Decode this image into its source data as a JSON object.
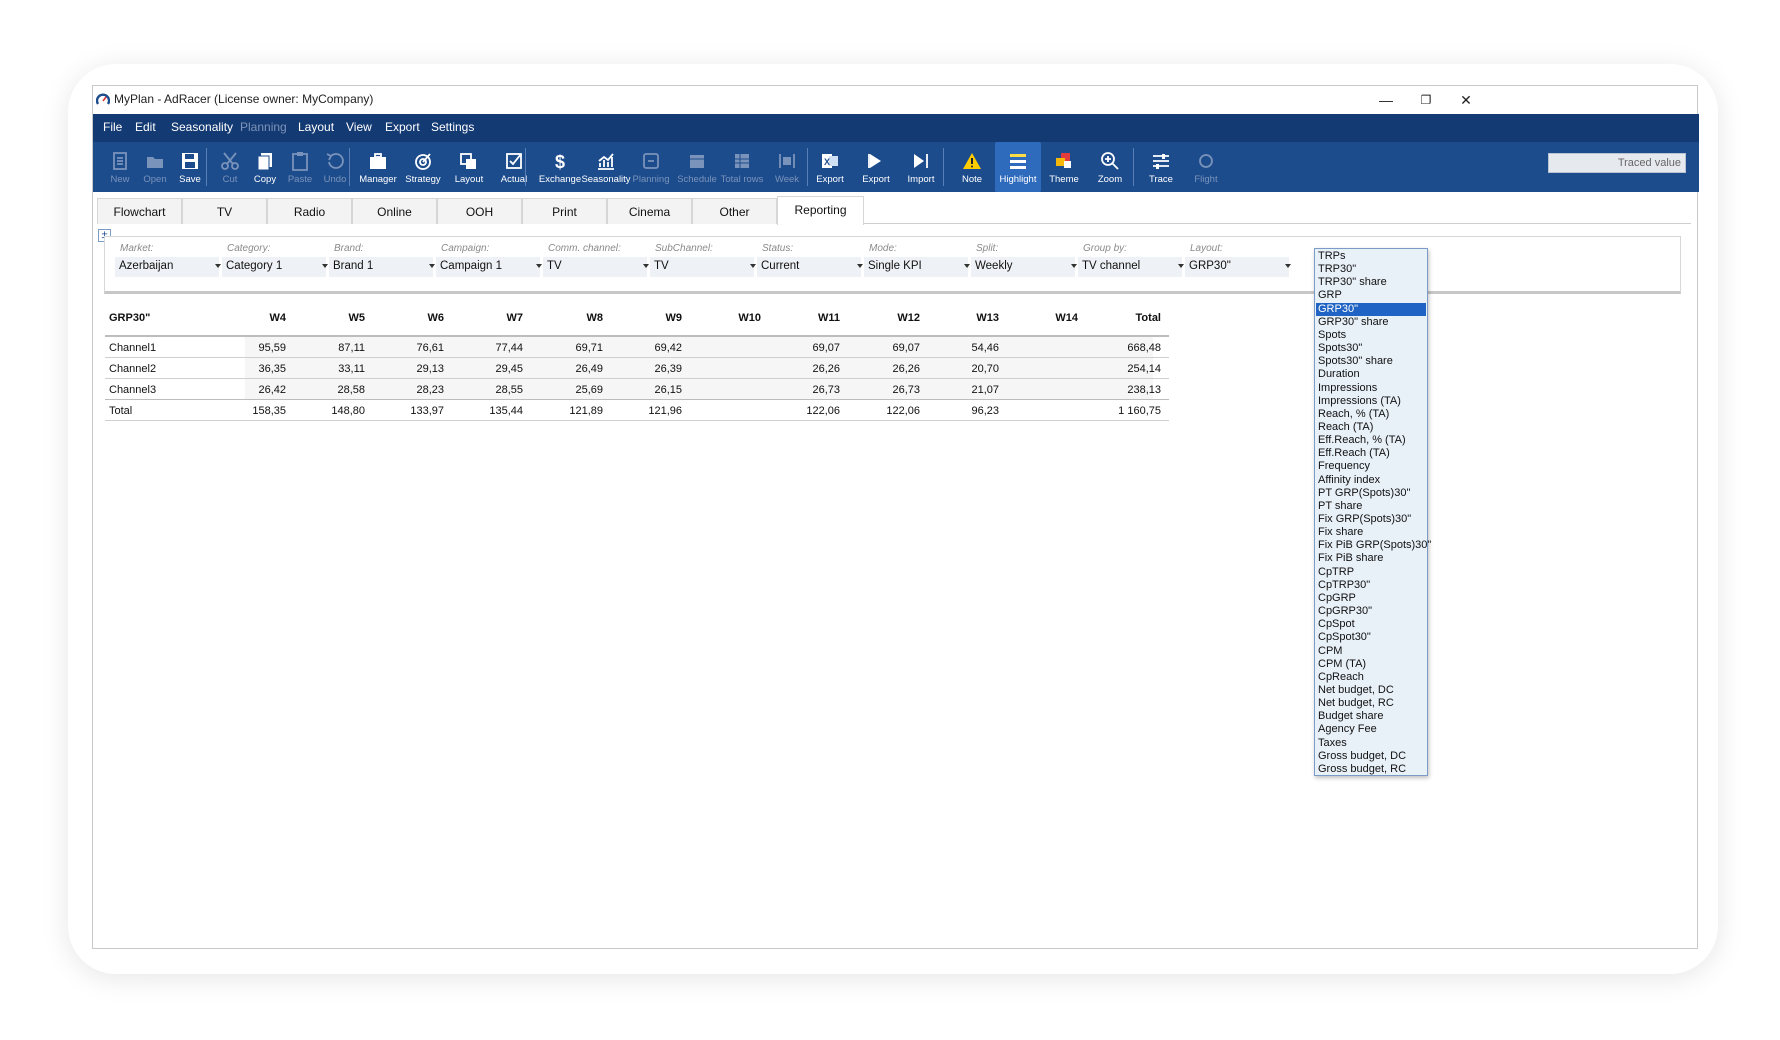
{
  "window": {
    "title": "MyPlan - AdRacer (License owner: MyCompany)",
    "controls": [
      "—",
      "❐",
      "✕"
    ]
  },
  "menu": [
    {
      "label": "File",
      "enabled": true
    },
    {
      "label": "Edit",
      "enabled": true
    },
    {
      "label": "Seasonality",
      "enabled": true
    },
    {
      "label": "Planning",
      "enabled": false
    },
    {
      "label": "Layout",
      "enabled": true
    },
    {
      "label": "View",
      "enabled": true
    },
    {
      "label": "Export",
      "enabled": true
    },
    {
      "label": "Settings",
      "enabled": true
    }
  ],
  "toolbar": {
    "buttons": [
      {
        "label": "New",
        "icon": "new-doc-icon",
        "enabled": false
      },
      {
        "label": "Open",
        "icon": "folder-icon",
        "enabled": false
      },
      {
        "label": "Save",
        "icon": "save-icon",
        "enabled": true
      },
      {
        "label": "Cut",
        "icon": "scissors-icon",
        "enabled": false
      },
      {
        "label": "Copy",
        "icon": "copy-icon",
        "enabled": true
      },
      {
        "label": "Paste",
        "icon": "paste-icon",
        "enabled": false
      },
      {
        "label": "Undo",
        "icon": "undo-icon",
        "enabled": false
      },
      {
        "label": "Manager",
        "icon": "briefcase-icon",
        "enabled": true
      },
      {
        "label": "Strategy",
        "icon": "target-icon",
        "enabled": true
      },
      {
        "label": "Layout",
        "icon": "layout-icon",
        "enabled": true
      },
      {
        "label": "Actual",
        "icon": "check-icon",
        "enabled": true
      },
      {
        "label": "Exchange",
        "icon": "dollar-icon",
        "enabled": true
      },
      {
        "label": "Seasonality",
        "icon": "chart-icon",
        "enabled": true
      },
      {
        "label": "Planning",
        "icon": "planning-icon",
        "enabled": false
      },
      {
        "label": "Schedule",
        "icon": "schedule-icon",
        "enabled": false
      },
      {
        "label": "Total rows",
        "icon": "total-rows-icon",
        "enabled": false
      },
      {
        "label": "Week",
        "icon": "week-icon",
        "enabled": false
      },
      {
        "label": "Export",
        "icon": "excel-icon",
        "enabled": true
      },
      {
        "label": "Export",
        "icon": "export-icon",
        "enabled": true
      },
      {
        "label": "Import",
        "icon": "import-icon",
        "enabled": true
      },
      {
        "label": "Note",
        "icon": "warning-icon",
        "enabled": true
      },
      {
        "label": "Highlight",
        "icon": "highlight-icon",
        "enabled": true,
        "active": true
      },
      {
        "label": "Theme",
        "icon": "theme-icon",
        "enabled": true
      },
      {
        "label": "Zoom",
        "icon": "zoom-icon",
        "enabled": true
      },
      {
        "label": "Trace",
        "icon": "trace-icon",
        "enabled": true
      },
      {
        "label": "Flight",
        "icon": "flight-icon",
        "enabled": false
      }
    ],
    "traced_placeholder": "Traced value"
  },
  "tabs": [
    "Flowchart",
    "TV",
    "Radio",
    "Online",
    "OOH",
    "Print",
    "Cinema",
    "Other",
    "Reporting"
  ],
  "active_tab": "Reporting",
  "filters": [
    {
      "label": "Market:",
      "value": "Azerbaijan"
    },
    {
      "label": "Category:",
      "value": "Category 1"
    },
    {
      "label": "Brand:",
      "value": "Brand 1"
    },
    {
      "label": "Campaign:",
      "value": "Campaign 1"
    },
    {
      "label": "Comm. channel:",
      "value": "TV"
    },
    {
      "label": "SubChannel:",
      "value": "TV"
    },
    {
      "label": "Status:",
      "value": "Current"
    },
    {
      "label": "Mode:",
      "value": "Single KPI"
    },
    {
      "label": "Split:",
      "value": "Weekly"
    },
    {
      "label": "Group by:",
      "value": "TV channel"
    },
    {
      "label": "Layout:",
      "value": "GRP30\""
    }
  ],
  "table": {
    "corner": "GRP30\"",
    "columns": [
      "W4",
      "W5",
      "W6",
      "W7",
      "W8",
      "W9",
      "W10",
      "W11",
      "W12",
      "W13",
      "W14",
      "Total"
    ],
    "rows": [
      {
        "name": "Channel1",
        "values": [
          "95,59",
          "87,11",
          "76,61",
          "77,44",
          "69,71",
          "69,42",
          "",
          "69,07",
          "69,07",
          "54,46",
          "",
          "668,48"
        ]
      },
      {
        "name": "Channel2",
        "values": [
          "36,35",
          "33,11",
          "29,13",
          "29,45",
          "26,49",
          "26,39",
          "",
          "26,26",
          "26,26",
          "20,70",
          "",
          "254,14"
        ]
      },
      {
        "name": "Channel3",
        "values": [
          "26,42",
          "28,58",
          "28,23",
          "28,55",
          "25,69",
          "26,15",
          "",
          "26,73",
          "26,73",
          "21,07",
          "",
          "238,13"
        ]
      },
      {
        "name": "Total",
        "values": [
          "158,35",
          "148,80",
          "133,97",
          "135,44",
          "121,89",
          "121,96",
          "",
          "122,06",
          "122,06",
          "96,23",
          "",
          "1 160,75"
        ]
      }
    ]
  },
  "layout_dropdown": {
    "selected": "GRP30\"",
    "options": [
      "TRPs",
      "TRP30\"",
      "TRP30\" share",
      "GRP",
      "GRP30\"",
      "GRP30\" share",
      "Spots",
      "Spots30\"",
      "Spots30\" share",
      "Duration",
      "Impressions",
      "Impressions (TA)",
      "Reach, % (TA)",
      "Reach (TA)",
      "Eff.Reach, % (TA)",
      "Eff.Reach (TA)",
      "Frequency",
      "Affinity index",
      "PT GRP(Spots)30\"",
      "PT share",
      "Fix GRP(Spots)30\"",
      "Fix share",
      "Fix PiB GRP(Spots)30\"",
      "Fix PiB share",
      "CpTRP",
      "CpTRP30\"",
      "CpGRP",
      "CpGRP30\"",
      "CpSpot",
      "CpSpot30\"",
      "CPM",
      "CPM (TA)",
      "CpReach",
      "Net budget, DC",
      "Net budget, RC",
      "Budget share",
      "Agency Fee",
      "Taxes",
      "Gross budget, DC",
      "Gross budget, RC"
    ]
  },
  "colors": {
    "menubar": "#143a73",
    "toolbar": "#1d4c8d",
    "selection": "#1f64c4",
    "dropdown_bg": "#e8f0f8"
  }
}
